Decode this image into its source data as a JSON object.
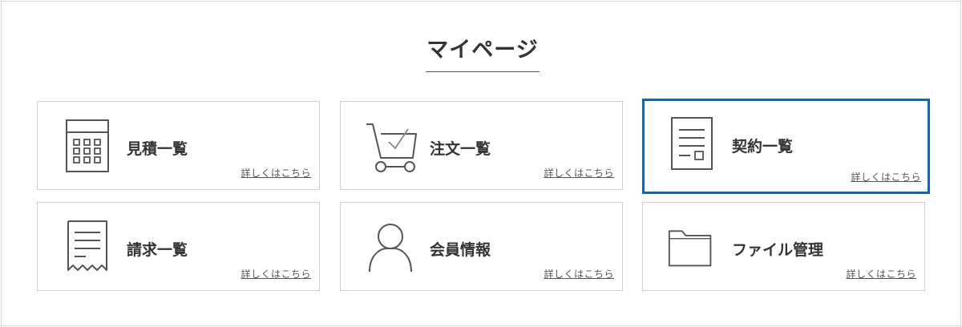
{
  "page": {
    "title": "マイページ"
  },
  "colors": {
    "accent": "#0a63c7",
    "border": "#cfcfcf"
  },
  "cards": [
    {
      "label": "見積一覧",
      "link": "詳しくはこちら",
      "icon": "calculator-icon"
    },
    {
      "label": "注文一覧",
      "link": "詳しくはこちら",
      "icon": "cart-icon"
    },
    {
      "label": "契約一覧",
      "link": "詳しくはこちら",
      "icon": "document-icon",
      "selected": true
    },
    {
      "label": "請求一覧",
      "link": "詳しくはこちら",
      "icon": "receipt-icon"
    },
    {
      "label": "会員情報",
      "link": "詳しくはこちら",
      "icon": "person-icon"
    },
    {
      "label": "ファイル管理",
      "link": "詳しくはこちら",
      "icon": "folder-icon"
    }
  ]
}
